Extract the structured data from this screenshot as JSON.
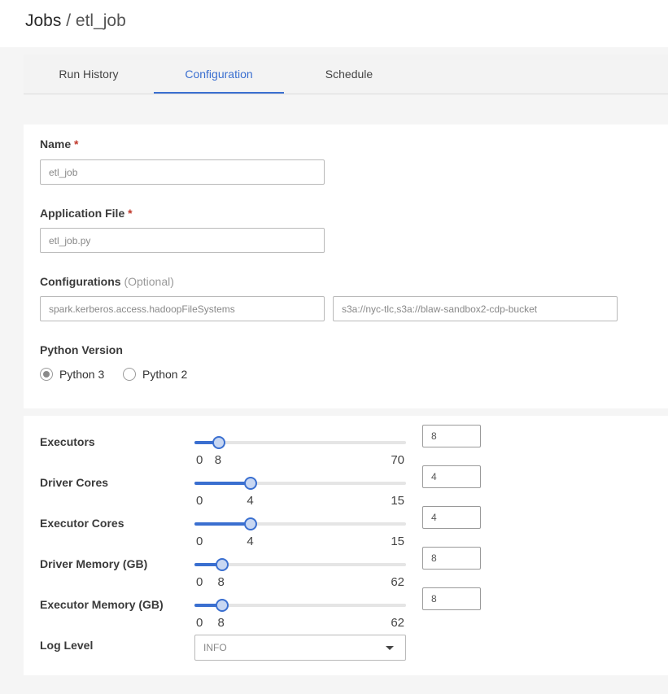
{
  "header": {
    "root": "Jobs",
    "separator": "/",
    "job": "etl_job"
  },
  "tabs": [
    {
      "label": "Run History",
      "active": false
    },
    {
      "label": "Configuration",
      "active": true
    },
    {
      "label": "Schedule",
      "active": false
    }
  ],
  "form": {
    "name": {
      "label": "Name",
      "required": "*",
      "value": "etl_job"
    },
    "app_file": {
      "label": "Application File",
      "required": "*",
      "value": "etl_job.py"
    },
    "configurations": {
      "label": "Configurations",
      "optional": "(Optional)",
      "key": "spark.kerberos.access.hadoopFileSystems",
      "value": "s3a://nyc-tlc,s3a://blaw-sandbox2-cdp-bucket"
    },
    "python": {
      "label": "Python Version",
      "options": [
        "Python 3",
        "Python 2"
      ],
      "selected": "Python 3"
    }
  },
  "resources": {
    "executors": {
      "label": "Executors",
      "min": 0,
      "max": 70,
      "value": 8
    },
    "driver_cores": {
      "label": "Driver Cores",
      "min": 0,
      "max": 15,
      "value": 4
    },
    "executor_cores": {
      "label": "Executor Cores",
      "min": 0,
      "max": 15,
      "value": 4
    },
    "driver_memory": {
      "label": "Driver Memory (GB)",
      "min": 0,
      "max": 62,
      "value": 8
    },
    "executor_memory": {
      "label": "Executor Memory (GB)",
      "min": 0,
      "max": 62,
      "value": 8
    },
    "log_level": {
      "label": "Log Level",
      "value": "INFO"
    }
  },
  "colors": {
    "accent": "#3a6fd0",
    "required": "#c0392b"
  },
  "icons": {
    "dropdown": "chevron-down-icon"
  }
}
